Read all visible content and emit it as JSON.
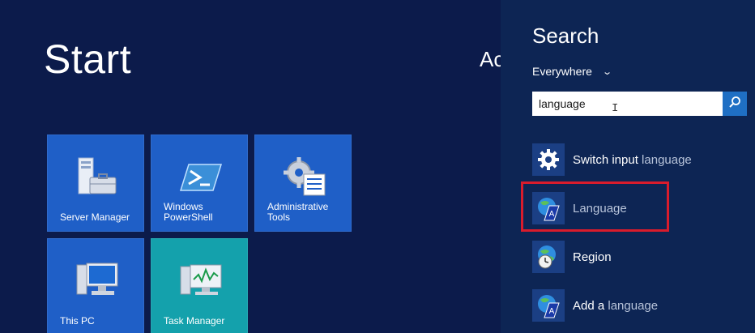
{
  "start": {
    "title": "Start",
    "user_partial": "Ac"
  },
  "tiles": [
    {
      "label": "Server Manager",
      "icon": "server-manager-icon"
    },
    {
      "label": "Windows\nPowerShell",
      "icon": "powershell-icon"
    },
    {
      "label": "Administrative\nTools",
      "icon": "admin-tools-icon"
    },
    {
      "label": "This PC",
      "icon": "computer-icon"
    },
    {
      "label": "Task Manager",
      "icon": "task-manager-icon"
    }
  ],
  "search": {
    "title": "Search",
    "scope": "Everywhere",
    "query": "language",
    "results": [
      {
        "prefix": "Switch input ",
        "match": "language",
        "icon": "gear-icon"
      },
      {
        "prefix": "",
        "match": "Language",
        "icon": "globe-language-icon"
      },
      {
        "prefix": "Region",
        "match": "",
        "icon": "globe-clock-icon"
      },
      {
        "prefix": "Add a ",
        "match": "language",
        "icon": "globe-language-icon"
      }
    ]
  },
  "colors": {
    "background": "#0c1b4b",
    "tile_blue": "#1f5fc7",
    "tile_teal": "#14a1ac",
    "search_pane": "#0d2554",
    "highlight": "#d91c2c"
  }
}
